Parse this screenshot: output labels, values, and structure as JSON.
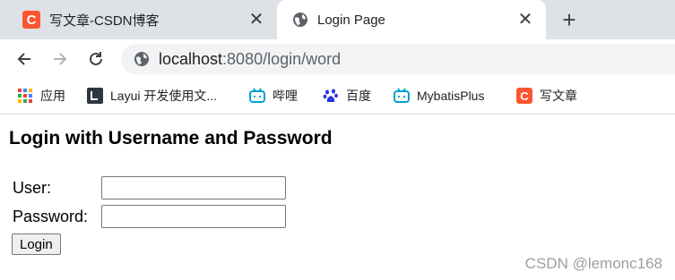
{
  "tabs": [
    {
      "title": "写文章-CSDN博客",
      "active": false,
      "icon": "csdn-c-icon"
    },
    {
      "title": "Login Page",
      "active": true,
      "icon": "globe-icon"
    }
  ],
  "address": {
    "host": "localhost",
    "rest": ":8080/login/word"
  },
  "bookmarks": [
    {
      "label": "应用",
      "icon": "apps-grid-icon"
    },
    {
      "label": "Layui 开发使用文...",
      "icon": "layui-icon"
    },
    {
      "label": "哔哩",
      "icon": "bilibili-icon"
    },
    {
      "label": "百度",
      "icon": "baidu-paw-icon"
    },
    {
      "label": "MybatisPlus",
      "icon": "bilibili-icon"
    },
    {
      "label": "写文章",
      "icon": "csdn-c-icon"
    }
  ],
  "page": {
    "heading": "Login with Username and Password",
    "username_label": "User:",
    "password_label": "Password:",
    "username_value": "",
    "password_value": "",
    "login_button": "Login"
  },
  "watermark": "CSDN @lemonc168",
  "colors": {
    "csdn_red": "#fc5531",
    "bilibili_blue": "#00a1d6",
    "baidu_blue": "#2932e1",
    "tabstrip": "#dee1e6"
  }
}
